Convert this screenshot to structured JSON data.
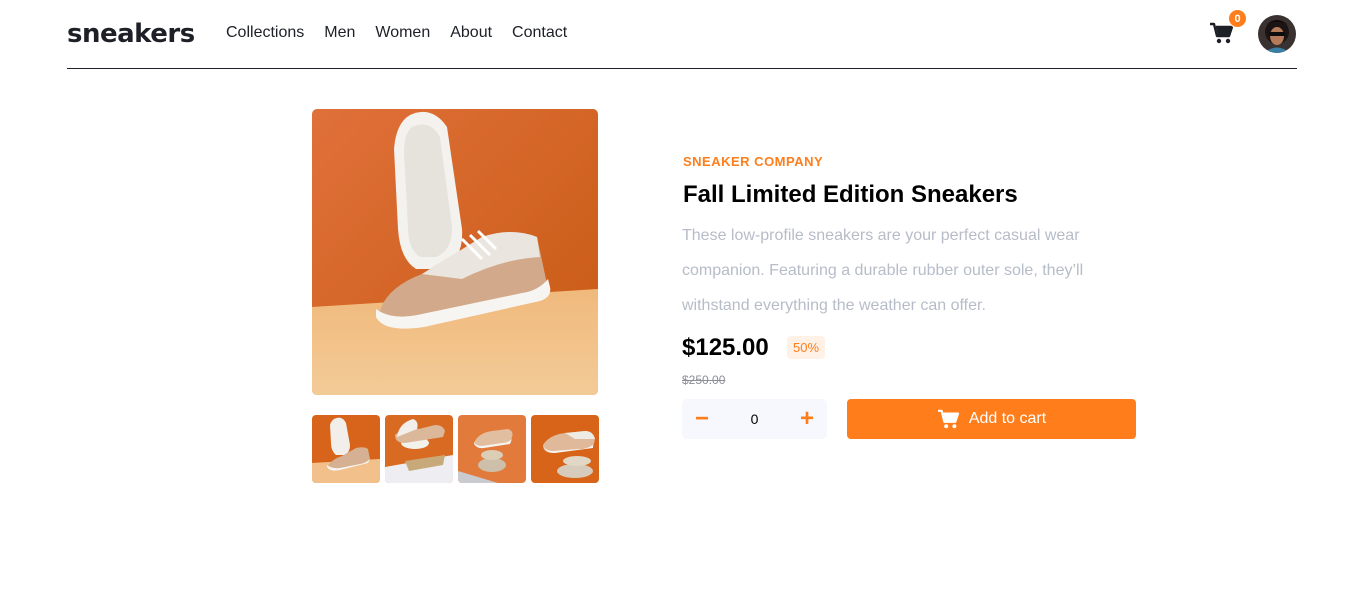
{
  "header": {
    "logo": "sneakers",
    "nav": [
      "Collections",
      "Men",
      "Women",
      "About",
      "Contact"
    ],
    "cart_count": "0",
    "cart_icon": "cart-icon",
    "avatar": "user-avatar"
  },
  "product": {
    "company": "SNEAKER COMPANY",
    "title": "Fall Limited Edition Sneakers",
    "description": "These low-profile sneakers are your perfect casual wear companion. Featuring a durable rubber outer sole, they’ll withstand everything the weather can offer.",
    "price": "$125.00",
    "discount": "50%",
    "original_price": "$250.00"
  },
  "quantity": {
    "value": "0",
    "minus": "−",
    "plus": "+"
  },
  "add_to_cart": {
    "label": "Add to cart"
  },
  "colors": {
    "accent": "#ff7e1b",
    "accent_pale": "#fff1e6",
    "text_dark": "#1d2026",
    "text_muted": "#b6bcc8"
  }
}
